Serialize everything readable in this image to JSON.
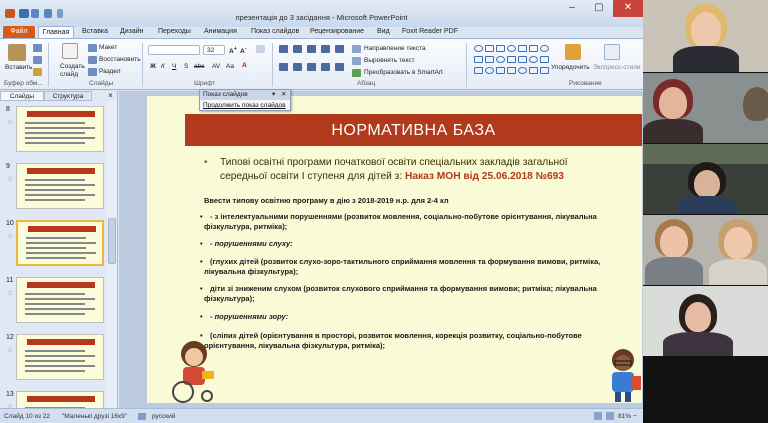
{
  "window": {
    "title": "презентація до 3 засідання - Microsoft PowerPoint",
    "controls": [
      "–",
      "▢",
      "✕"
    ]
  },
  "tabs": [
    "Файл",
    "Главная",
    "Вставка",
    "Дизайн",
    "Переходы",
    "Анимация",
    "Показ слайдов",
    "Рецензирование",
    "Вид",
    "Foxit Reader PDF"
  ],
  "ribbon": {
    "paste": "Вставить",
    "new_slide": "Создать слайд",
    "layout": "Макет",
    "reset": "Восстановить",
    "section": "Раздел",
    "font_size": "32",
    "text_direction": "Направление текста",
    "align_text": "Выровнять текст",
    "smartart": "Преобразовать в SmartArt",
    "arrange": "Упорядочить",
    "quick_styles": "Экспресс-стили",
    "groups": {
      "clipboard": "Буфер обм...",
      "slides": "Слайды",
      "font": "Шрифт",
      "paragraph": "Абзац",
      "drawing": "Рисование"
    }
  },
  "pane": {
    "tab_slides": "Слайды",
    "tab_outline": "Структура",
    "numbers": [
      "8",
      "9",
      "10",
      "11",
      "12",
      "13"
    ]
  },
  "slide": {
    "title": "НОРМАТИВНА БАЗА",
    "main_line1": "Типові   освітні   програми  початкової освіти спеціальних закладів загальної",
    "main_line2_prefix": "середньої освіти І ступеня  для дітей з: ",
    "main_line2_bold": "Наказ МОН від 25.06.2018 №693",
    "lines": [
      "Ввести типову освітню програму в дію  з 2018-2019  н.р. для 2-4 кл",
      "- з інтелектуальними порушеннями (розвиток мовлення, соціально-побутове  орієнтування,  лікувальна",
      "фізкультура, ритміка);",
      "- порушеннями слуху:",
      "(глухих дітей (розвиток слухо-зоро-тактильного  сприймання мовлення та формування вимови, ритміка,",
      "лікувальна фізкультура);",
      "діти зі зниженим слухом (розвиток слухового сприймання та формування вимови;  ритміка; лікувальна",
      "фізкультура);",
      "- порушеннями  зору:",
      "(сліпих дітей (орієнтування  в просторі, розвиток мовлення, корекція розвитку,  соціально-побутове",
      "орієнтування,  лікувальна фізкультура, ритміка);"
    ]
  },
  "popup": {
    "header": "Показ слайдов",
    "item": "Продолжить показ слайдов"
  },
  "status": {
    "slide_of": "Слайд 10 из 22",
    "theme": "\"Маленькі друзі 16x9\"",
    "language": "русский",
    "zoom": "81%"
  }
}
